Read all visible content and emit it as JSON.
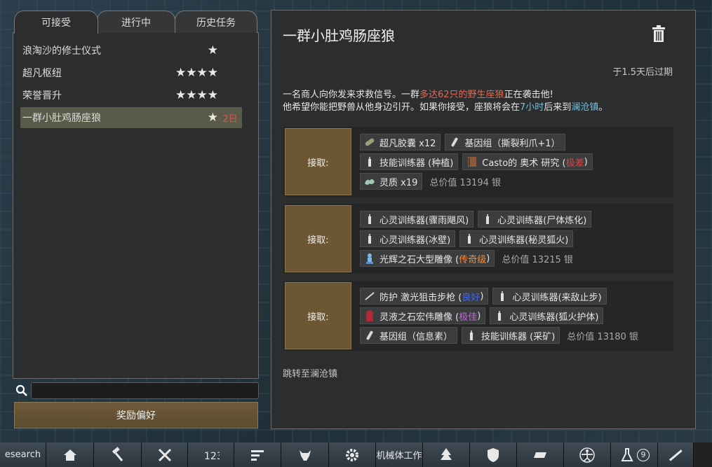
{
  "tabs": [
    {
      "label": "可接受"
    },
    {
      "label": "进行中"
    },
    {
      "label": "历史任务"
    }
  ],
  "quests": [
    {
      "name": "浪淘沙的修士仪式",
      "stars": "★",
      "days": ""
    },
    {
      "name": "超凡枢纽",
      "stars": "★★★★",
      "days": ""
    },
    {
      "name": "荣誉晋升",
      "stars": "★★★★",
      "days": ""
    },
    {
      "name": "一群小肚鸡肠座狼",
      "stars": "★",
      "days": "2日",
      "selected": true
    }
  ],
  "search": {
    "value": ""
  },
  "reward_pref_label": "奖励偏好",
  "detail": {
    "title": "一群小肚鸡肠座狼",
    "expire": "于1.5天后过期",
    "desc_1a": "一名商人向你发来求救信号。一群",
    "desc_1b": "多达62只的野生座狼",
    "desc_1c": "正在袭击他!",
    "desc_2a": "他希望你能把野兽从他身边引开。如果你接受，座狼将会在",
    "desc_2b": "7小时",
    "desc_2c": "后来到",
    "desc_2d": "澜沧镇",
    "desc_2e": "。",
    "accept_label": "接取:",
    "jump_label": "跳转至澜沧镇"
  },
  "options": [
    {
      "rows": [
        [
          {
            "label": "超凡胶囊 x12",
            "icon": "capsule-icon"
          },
          {
            "label": "基因组（撕裂利爪+1）",
            "icon": "gene-icon"
          }
        ],
        [
          {
            "label": "技能训练器 (种植)",
            "icon": "trainer-icon"
          },
          {
            "label": "Casto的 奥术 研究 (",
            "quality": "极差",
            "tail": ")",
            "icon": "book-icon"
          }
        ],
        [
          {
            "label": "灵质 x19",
            "icon": "psyche-icon"
          }
        ]
      ],
      "total": "总价值 13194 银"
    },
    {
      "rows": [
        [
          {
            "label": "心灵训练器(骤雨飓风)",
            "icon": "trainer-icon"
          },
          {
            "label": "心灵训练器(尸体炼化)",
            "icon": "trainer-icon"
          }
        ],
        [
          {
            "label": "心灵训练器(冰壁)",
            "icon": "trainer-icon"
          },
          {
            "label": "心灵训练器(秘灵狐火)",
            "icon": "trainer-icon"
          }
        ],
        [
          {
            "label": "光辉之石大型雕像 (",
            "quality": "传奇级",
            "tail": ")",
            "icon": "statue-icon"
          }
        ]
      ],
      "total": "总价值 13215 银"
    },
    {
      "rows": [
        [
          {
            "label": "防护 激光狙击步枪 (",
            "quality": "良好",
            "tail": ")",
            "icon": "rifle-icon"
          },
          {
            "label": "心灵训练器(来敌止步)",
            "icon": "trainer-icon"
          }
        ],
        [
          {
            "label": "灵液之石宏伟雕像 (",
            "quality": "极佳",
            "tail": ")",
            "icon": "grand-statue-icon"
          },
          {
            "label": "心灵训练器(狐火护体)",
            "icon": "trainer-icon"
          }
        ],
        [
          {
            "label": "基因组（信息素）",
            "icon": "gene-icon"
          },
          {
            "label": "技能训练器 (采矿)",
            "icon": "trainer-icon"
          }
        ]
      ],
      "total": "总价值 13180 银"
    }
  ],
  "bottom_bar": [
    {
      "label": "esearch",
      "icon": ""
    },
    {
      "label": "",
      "icon": "home-icon"
    },
    {
      "label": "",
      "icon": "hammer-icon"
    },
    {
      "label": "",
      "icon": "architect-icon"
    },
    {
      "label": "",
      "icon": "work-priorities-icon"
    },
    {
      "label": "",
      "icon": "assign-icon"
    },
    {
      "label": "",
      "icon": "animals-icon"
    },
    {
      "label": "",
      "icon": "gear-icon"
    },
    {
      "label": "机械体工作",
      "icon": ""
    },
    {
      "label": "",
      "icon": "tree-icon"
    },
    {
      "label": "",
      "icon": "shield-icon"
    },
    {
      "label": "",
      "icon": "table-icon"
    },
    {
      "label": "",
      "icon": "vitruvian-icon"
    },
    {
      "label": "9",
      "icon": "flask-icon"
    },
    {
      "label": "",
      "icon": "rifle-icon"
    }
  ],
  "colors": {
    "accent_button": "#6d5633",
    "panel_bg": "#2b2d2f",
    "highlight_red": "#e06b55",
    "highlight_blue": "#6fc0e0",
    "quality_bad": "#e04444",
    "quality_legendary": "#ff8c2a",
    "quality_good": "#3a66ff",
    "quality_excellent": "#c569e0"
  }
}
